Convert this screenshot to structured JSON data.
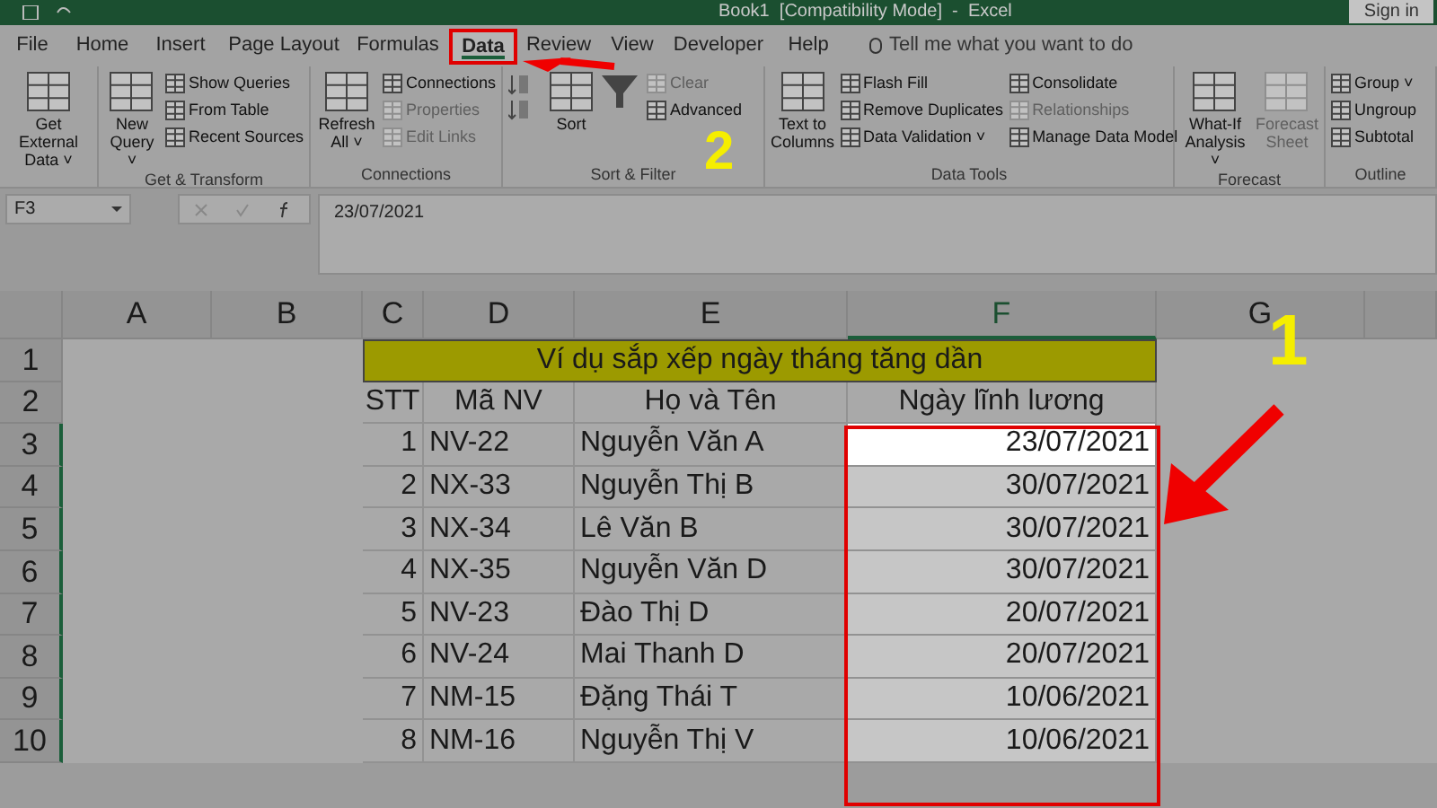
{
  "window": {
    "title": "Book1  [Compatibility Mode]  -  Excel",
    "sign_in": "Sign in"
  },
  "tabs": [
    {
      "label": "File",
      "selected": false
    },
    {
      "label": "Home",
      "selected": false
    },
    {
      "label": "Insert",
      "selected": false
    },
    {
      "label": "Page Layout",
      "selected": false
    },
    {
      "label": "Formulas",
      "selected": false
    },
    {
      "label": "Data",
      "selected": true
    },
    {
      "label": "Review",
      "selected": false
    },
    {
      "label": "View",
      "selected": false
    },
    {
      "label": "Developer",
      "selected": false
    },
    {
      "label": "Help",
      "selected": false
    }
  ],
  "tell_me": {
    "placeholder": "Tell me what you want to do"
  },
  "ribbon": [
    {
      "buttons": [
        {
          "kind": "large",
          "label": "Get External Data ˅",
          "disabled": false
        }
      ]
    },
    {
      "label": "Get & Transform",
      "buttons": [
        {
          "kind": "large",
          "label": "New Query ˅",
          "disabled": false
        },
        {
          "kind": "small",
          "label": "Show Queries",
          "disabled": false
        },
        {
          "kind": "small",
          "label": "From Table",
          "disabled": false
        },
        {
          "kind": "small",
          "label": "Recent Sources",
          "disabled": false
        }
      ]
    },
    {
      "label": "Connections",
      "buttons": [
        {
          "kind": "large",
          "label": "Refresh All ˅",
          "disabled": false
        },
        {
          "kind": "small",
          "label": "Connections",
          "disabled": false
        },
        {
          "kind": "small",
          "label": "Properties",
          "disabled": true
        },
        {
          "kind": "small",
          "label": "Edit Links",
          "disabled": true
        }
      ]
    },
    {
      "label": "Sort & Filter",
      "buttons": [
        {
          "kind": "sortpair",
          "disabled": false
        },
        {
          "kind": "large",
          "label": "Sort",
          "disabled": false
        },
        {
          "kind": "funnel",
          "disabled": false
        },
        {
          "kind": "small",
          "label": "Clear",
          "disabled": true
        },
        {
          "kind": "small",
          "label": "Advanced",
          "disabled": false
        }
      ]
    },
    {
      "label": "Data Tools",
      "buttons": [
        {
          "kind": "large",
          "label": "Text to Columns",
          "disabled": false
        },
        {
          "kind": "small",
          "label": "Flash Fill",
          "disabled": false
        },
        {
          "kind": "small",
          "label": "Remove Duplicates",
          "disabled": false
        },
        {
          "kind": "small",
          "label": "Data Validation ˅",
          "disabled": false
        },
        {
          "kind": "small",
          "label": "Consolidate",
          "disabled": false
        },
        {
          "kind": "small",
          "label": "Relationships",
          "disabled": true
        },
        {
          "kind": "small",
          "label": "Manage Data Model",
          "disabled": false
        }
      ]
    },
    {
      "label": "Forecast",
      "buttons": [
        {
          "kind": "large",
          "label": "What-If Analysis ˅",
          "disabled": false
        },
        {
          "kind": "large",
          "label": "Forecast Sheet",
          "disabled": true
        }
      ]
    },
    {
      "label": "Outline",
      "buttons": [
        {
          "kind": "small",
          "label": "Group ˅",
          "disabled": false
        },
        {
          "kind": "small",
          "label": "Ungroup",
          "disabled": false
        },
        {
          "kind": "small",
          "label": "Subtotal",
          "disabled": false
        }
      ]
    }
  ],
  "formula_bar": {
    "name_box": "F3",
    "value": "23/07/2021"
  },
  "sheet": {
    "columns": [
      {
        "label": "A",
        "selected": false
      },
      {
        "label": "B",
        "selected": false
      },
      {
        "label": "C",
        "selected": false
      },
      {
        "label": "D",
        "selected": false
      },
      {
        "label": "E",
        "selected": false
      },
      {
        "label": "F",
        "selected": true
      },
      {
        "label": "G",
        "selected": false
      }
    ],
    "row_headers": [
      {
        "label": "1",
        "selected": false
      },
      {
        "label": "2",
        "selected": false
      },
      {
        "label": "3",
        "selected": true
      },
      {
        "label": "4",
        "selected": true
      },
      {
        "label": "5",
        "selected": true
      },
      {
        "label": "6",
        "selected": true
      },
      {
        "label": "7",
        "selected": true
      },
      {
        "label": "8",
        "selected": true
      },
      {
        "label": "9",
        "selected": true
      },
      {
        "label": "10",
        "selected": true
      }
    ],
    "title": "Ví dụ sắp xếp ngày tháng tăng dần",
    "headers": [
      "STT",
      "Mã NV",
      "Họ và Tên",
      "Ngày lĩnh lương"
    ],
    "rows": [
      {
        "stt": "1",
        "code": "NV-22",
        "name": "Nguyễn Văn A",
        "date": "23/07/2021",
        "selected": true,
        "active": true
      },
      {
        "stt": "2",
        "code": "NX-33",
        "name": "Nguyễn Thị B",
        "date": "30/07/2021",
        "selected": true,
        "active": false
      },
      {
        "stt": "3",
        "code": "NX-34",
        "name": "Lê Văn B",
        "date": "30/07/2021",
        "selected": true,
        "active": false
      },
      {
        "stt": "4",
        "code": "NX-35",
        "name": "Nguyễn Văn D",
        "date": "30/07/2021",
        "selected": true,
        "active": false
      },
      {
        "stt": "5",
        "code": "NV-23",
        "name": "Đào Thị D",
        "date": "20/07/2021",
        "selected": true,
        "active": false
      },
      {
        "stt": "6",
        "code": "NV-24",
        "name": "Mai Thanh D",
        "date": "20/07/2021",
        "selected": true,
        "active": false
      },
      {
        "stt": "7",
        "code": "NM-15",
        "name": "Đặng Thái T",
        "date": "10/06/2021",
        "selected": true,
        "active": false
      },
      {
        "stt": "8",
        "code": "NM-16",
        "name": "Nguyễn Thị V",
        "date": "10/06/2021",
        "selected": true,
        "active": false
      }
    ]
  },
  "annotations": [
    {
      "text": "1"
    },
    {
      "text": "2"
    }
  ]
}
